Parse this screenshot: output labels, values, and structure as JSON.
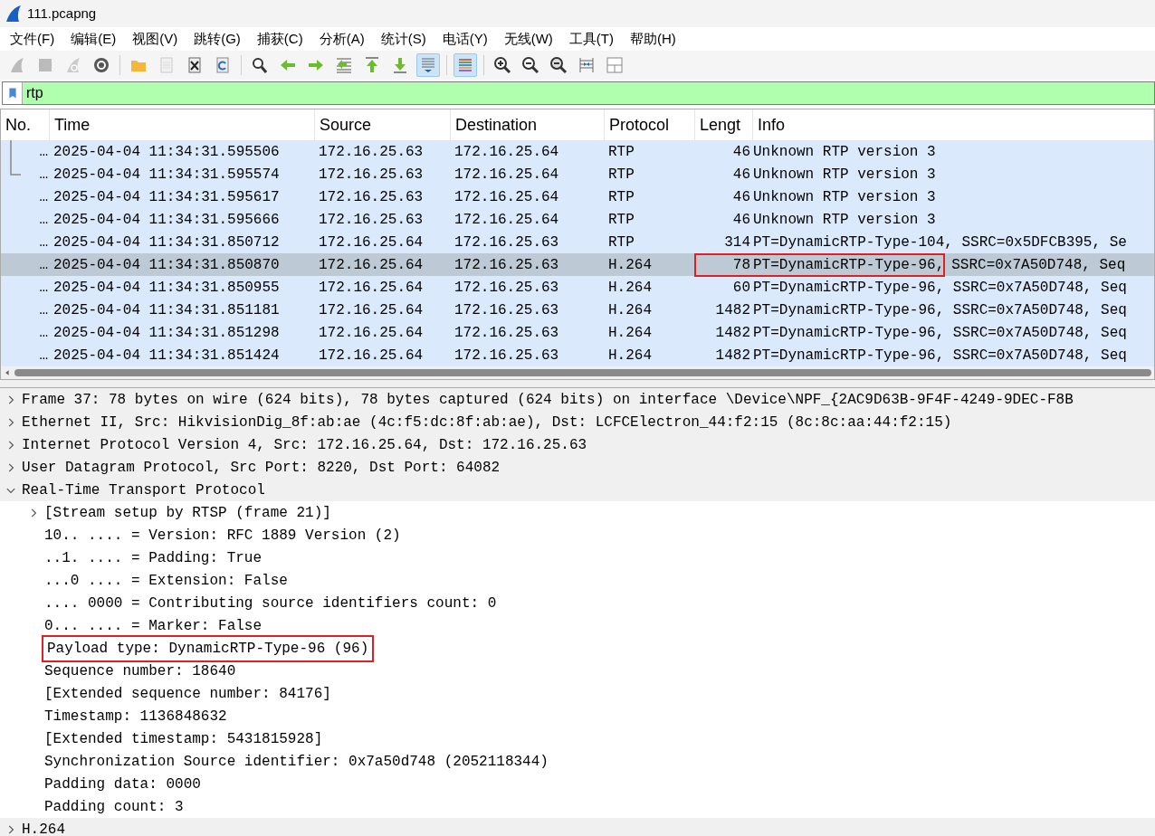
{
  "window": {
    "title": "111.pcapng"
  },
  "menu": [
    {
      "label": "文件(F)"
    },
    {
      "label": "编辑(E)"
    },
    {
      "label": "视图(V)"
    },
    {
      "label": "跳转(G)"
    },
    {
      "label": "捕获(C)"
    },
    {
      "label": "分析(A)"
    },
    {
      "label": "统计(S)"
    },
    {
      "label": "电话(Y)"
    },
    {
      "label": "无线(W)"
    },
    {
      "label": "工具(T)"
    },
    {
      "label": "帮助(H)"
    }
  ],
  "toolbar": [
    {
      "kind": "fin",
      "disabled": true
    },
    {
      "kind": "stop",
      "disabled": true
    },
    {
      "kind": "restart",
      "disabled": true
    },
    {
      "kind": "gear",
      "disabled": false
    },
    {
      "kind": "sep"
    },
    {
      "kind": "folder",
      "disabled": false
    },
    {
      "kind": "file",
      "disabled": true
    },
    {
      "kind": "closefile",
      "disabled": false
    },
    {
      "kind": "reload",
      "disabled": false
    },
    {
      "kind": "sep"
    },
    {
      "kind": "search",
      "disabled": false
    },
    {
      "kind": "left",
      "disabled": false
    },
    {
      "kind": "right",
      "disabled": false
    },
    {
      "kind": "goto",
      "disabled": false
    },
    {
      "kind": "first",
      "disabled": false
    },
    {
      "kind": "last",
      "disabled": false
    },
    {
      "kind": "autoscroll",
      "on": true
    },
    {
      "kind": "sep"
    },
    {
      "kind": "colorize",
      "on": true
    },
    {
      "kind": "sep"
    },
    {
      "kind": "zoomin",
      "disabled": false
    },
    {
      "kind": "zoomout",
      "disabled": false
    },
    {
      "kind": "zoomnormal",
      "disabled": false
    },
    {
      "kind": "resize",
      "disabled": false
    },
    {
      "kind": "layout",
      "disabled": false
    }
  ],
  "filter": {
    "value": "rtp"
  },
  "packet_list": {
    "columns": [
      "No.",
      "Time",
      "Source",
      "Destination",
      "Protocol",
      "Lengt",
      "Info"
    ],
    "rows": [
      {
        "no": "…",
        "time": "2025-04-04 11:34:31.595506",
        "source": "172.16.25.63",
        "destination": "172.16.25.64",
        "protocol": "RTP",
        "length": "46",
        "info": "Unknown RTP version 3",
        "kind": "related",
        "selected": false
      },
      {
        "no": "…",
        "time": "2025-04-04 11:34:31.595574",
        "source": "172.16.25.63",
        "destination": "172.16.25.64",
        "protocol": "RTP",
        "length": "46",
        "info": "Unknown RTP version 3",
        "kind": "lastrelated",
        "selected": false
      },
      {
        "no": "…",
        "time": "2025-04-04 11:34:31.595617",
        "source": "172.16.25.63",
        "destination": "172.16.25.64",
        "protocol": "RTP",
        "length": "46",
        "info": "Unknown RTP version 3",
        "selected": false
      },
      {
        "no": "…",
        "time": "2025-04-04 11:34:31.595666",
        "source": "172.16.25.63",
        "destination": "172.16.25.64",
        "protocol": "RTP",
        "length": "46",
        "info": "Unknown RTP version 3",
        "selected": false
      },
      {
        "no": "…",
        "time": "2025-04-04 11:34:31.850712",
        "source": "172.16.25.64",
        "destination": "172.16.25.63",
        "protocol": "RTP",
        "length": "314",
        "info": "PT=DynamicRTP-Type-104, SSRC=0x5DFCB395, Se",
        "selected": false
      },
      {
        "no": "…",
        "time": "2025-04-04 11:34:31.850870",
        "source": "172.16.25.64",
        "destination": "172.16.25.63",
        "protocol": "H.264",
        "length": "78",
        "boxed_info": "PT=DynamicRTP-Type-96,",
        "info": "SSRC=0x7A50D748, Seq",
        "selected": true
      },
      {
        "no": "…",
        "time": "2025-04-04 11:34:31.850955",
        "source": "172.16.25.64",
        "destination": "172.16.25.63",
        "protocol": "H.264",
        "length": "60",
        "info": "PT=DynamicRTP-Type-96, SSRC=0x7A50D748, Seq",
        "selected": false
      },
      {
        "no": "…",
        "time": "2025-04-04 11:34:31.851181",
        "source": "172.16.25.64",
        "destination": "172.16.25.63",
        "protocol": "H.264",
        "length": "1482",
        "info": "PT=DynamicRTP-Type-96, SSRC=0x7A50D748, Seq",
        "selected": false
      },
      {
        "no": "…",
        "time": "2025-04-04 11:34:31.851298",
        "source": "172.16.25.64",
        "destination": "172.16.25.63",
        "protocol": "H.264",
        "length": "1482",
        "info": "PT=DynamicRTP-Type-96, SSRC=0x7A50D748, Seq",
        "selected": false
      },
      {
        "no": "…",
        "time": "2025-04-04 11:34:31.851424",
        "source": "172.16.25.64",
        "destination": "172.16.25.63",
        "protocol": "H.264",
        "length": "1482",
        "info": "PT=DynamicRTP-Type-96, SSRC=0x7A50D748, Seq",
        "selected": false
      }
    ]
  },
  "details": [
    {
      "text": "Frame 37: 78 bytes on wire (624 bits), 78 bytes captured (624 bits) on interface \\Device\\NPF_{2AC9D63B-9F4F-4249-9DEC-F8B",
      "expanded": false
    },
    {
      "text": "Ethernet II, Src: HikvisionDig_8f:ab:ae (4c:f5:dc:8f:ab:ae), Dst: LCFCElectron_44:f2:15 (8c:8c:aa:44:f2:15)",
      "expanded": false
    },
    {
      "text": "Internet Protocol Version 4, Src: 172.16.25.64, Dst: 172.16.25.63",
      "expanded": false
    },
    {
      "text": "User Datagram Protocol, Src Port: 8220, Dst Port: 64082",
      "expanded": false
    },
    {
      "text": "Real-Time Transport Protocol",
      "expanded": true,
      "children": [
        {
          "text": "[Stream setup by RTSP (frame 21)]",
          "expanded": false
        },
        {
          "text": "10.. .... = Version: RFC 1889 Version (2)"
        },
        {
          "text": "..1. .... = Padding: True"
        },
        {
          "text": "...0 .... = Extension: False"
        },
        {
          "text": ".... 0000 = Contributing source identifiers count: 0"
        },
        {
          "text": "0... .... = Marker: False"
        },
        {
          "text": "Payload type: DynamicRTP-Type-96 (96)",
          "boxed": true
        },
        {
          "text": "Sequence number: 18640"
        },
        {
          "text": "[Extended sequence number: 84176]"
        },
        {
          "text": "Timestamp: 1136848632"
        },
        {
          "text": "[Extended timestamp: 5431815928]"
        },
        {
          "text": "Synchronization Source identifier: 0x7a50d748 (2052118344)"
        },
        {
          "text": "Padding data: 0000"
        },
        {
          "text": "Padding count: 3"
        }
      ]
    },
    {
      "text": "H.264",
      "expanded": false
    }
  ]
}
